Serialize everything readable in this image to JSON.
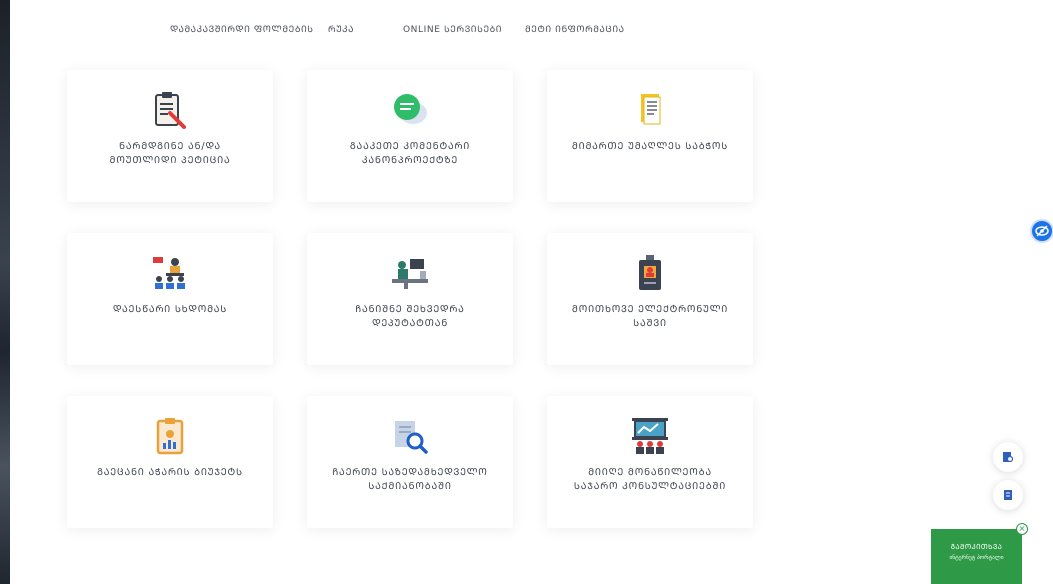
{
  "nav": {
    "items": [
      {
        "label": "ᲓᲐᲛᲐᲙᲐᲕᲨᲘᲠᲓᲘ ᲤᲝᲚᲛᲔᲑᲘᲡ"
      },
      {
        "label": "ᲠᲣᲙᲐ"
      },
      {
        "label": "ONLINE ᲡᲔᲠᲕᲘᲡᲔᲑᲘ"
      },
      {
        "label": "ᲛᲔᲢᲘ ᲘᲜᲤᲝᲠᲛᲐᲪᲘᲐ"
      }
    ]
  },
  "cards": [
    {
      "label": "ᲜᲐᲠᲛᲓᲒᲘᲜᲔ ᲐᲜ/ᲓᲐ ᲛᲝᲣᲗᲚᲘᲓᲘ ᲞᲔᲢᲘᲪᲘᲐ",
      "icon": "clipboard-pen-icon"
    },
    {
      "label": "ᲒᲐᲐᲙᲔᲗᲔ ᲙᲝᲛᲔᲜᲢᲐᲠᲘ ᲙᲐᲜᲝᲜᲞᲠᲝᲔᲥᲢᲖᲔ",
      "icon": "chat-bubble-icon"
    },
    {
      "label": "ᲛᲘᲛᲐᲠᲗᲔ ᲣᲛᲐᲦᲚᲔᲡ ᲡᲐᲑᲭᲝᲡ",
      "icon": "document-icon"
    },
    {
      "label": "ᲓᲐᲔᲡᲬᲐᲠᲘ ᲡᲮᲓᲝᲛᲐᲡ",
      "icon": "meeting-icon"
    },
    {
      "label": "ᲩᲐᲜᲘᲨᲜᲔ ᲨᲔᲮᲕᲔᲓᲠᲐ ᲓᲔᲞᲣᲢᲐᲢᲗᲐᲜ",
      "icon": "deputy-desk-icon"
    },
    {
      "label": "ᲛᲝᲘᲗᲮᲝᲕᲔ ᲔᲚᲔᲥᲢᲠᲝᲜᲣᲚᲘ ᲡᲐᲨᲕᲘ",
      "icon": "badge-icon"
    },
    {
      "label": "ᲒᲐᲔᲪᲐᲜᲘ ᲐᲭᲐᲠᲘᲡ ᲑᲘᲣᲯᲔᲢᲡ",
      "icon": "budget-report-icon"
    },
    {
      "label": "ᲩᲐᲔᲠᲗᲔ ᲡᲐᲖᲔᲓᲐᲛᲮᲔᲓᲕᲔᲚᲝ ᲡᲐᲥᲛᲘᲐᲜᲝᲑᲐᲨᲘ",
      "icon": "search-document-icon"
    },
    {
      "label": "ᲛᲘᲘᲦᲔ ᲛᲝᲜᲐᲬᲘᲚᲔᲝᲑᲐ ᲡᲐᲯᲐᲠᲝ ᲙᲝᲜᲡᲣᲚᲢᲐᲪᲘᲔᲑᲨᲘ",
      "icon": "presentation-icon"
    }
  ],
  "side": {
    "eye_icon": "eye-icon",
    "float_icons": [
      "document-search-icon",
      "document-icon"
    ]
  },
  "feedback": {
    "title": "ᲒᲐᲛᲝᲙᲘᲗᲮᲕᲐ",
    "subtitle": "ინტერნეტ პორტალი"
  },
  "colors": {
    "accent_blue": "#1d73e8",
    "green": "#2e9a47"
  }
}
